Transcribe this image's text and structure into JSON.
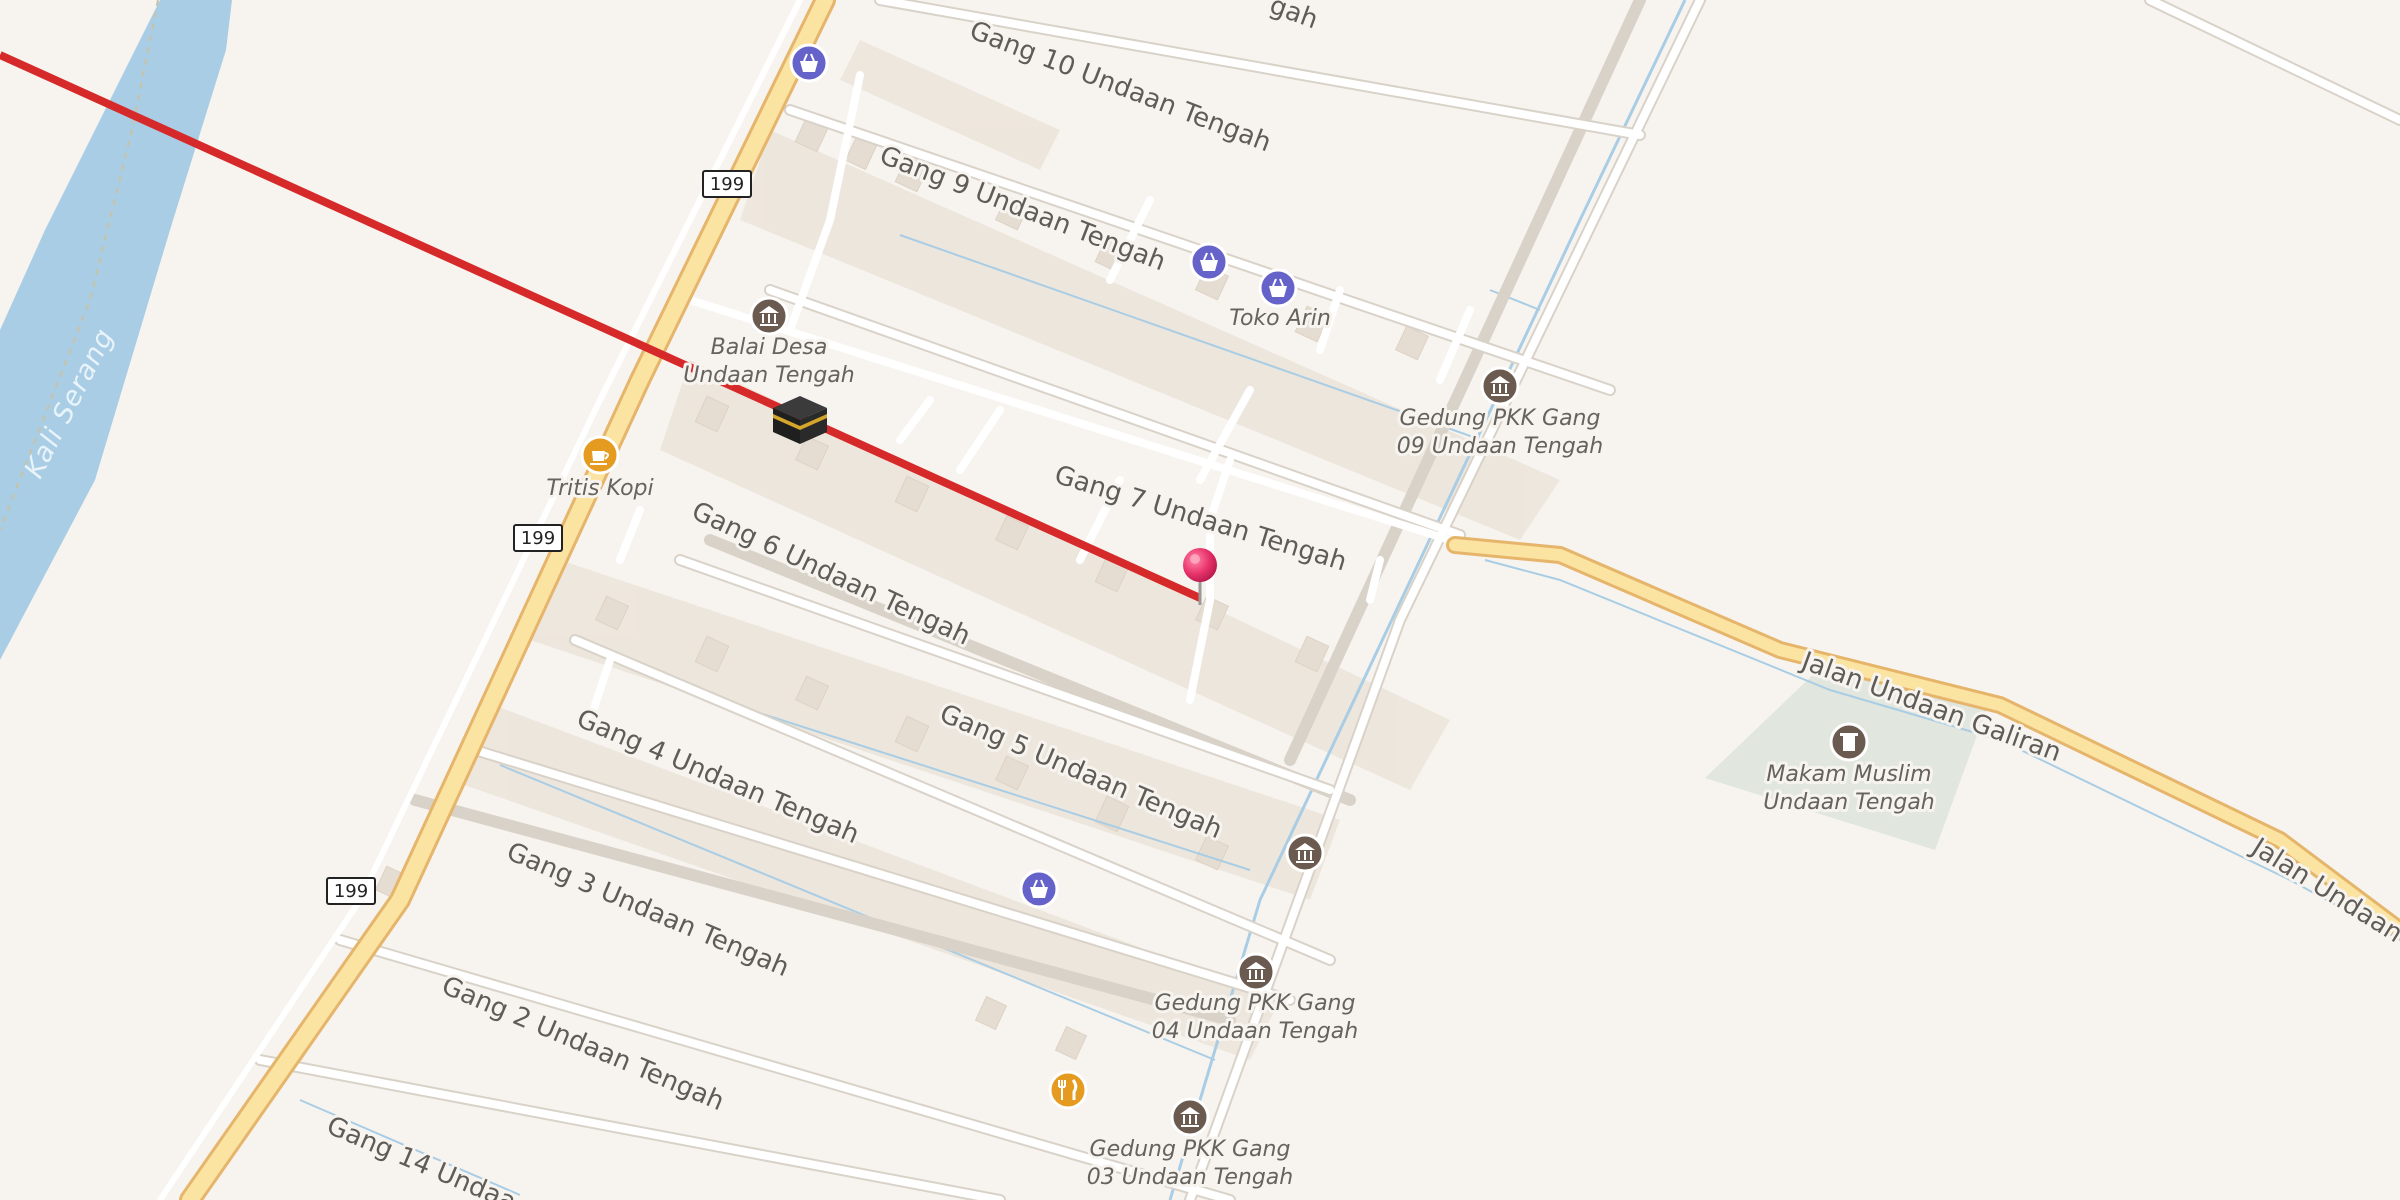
{
  "map": {
    "water": {
      "river_name": "Kali Serang"
    },
    "road_shields": [
      "199",
      "199",
      "199"
    ],
    "streets": {
      "gang10": "Gang 10 Undaan Tengah",
      "gang9": "Gang 9 Undaan Tengah",
      "gang7": "Gang 7 Undaan Tengah",
      "gang6": "Gang 6 Undaan Tengah",
      "gang5": "Gang 5 Undaan Tengah",
      "gang4": "Gang 4 Undaan Tengah",
      "gang3": "Gang 3 Undaan Tengah",
      "gang2": "Gang 2 Undaan Tengah",
      "gang14": "Gang 14 Undaa",
      "top_cut": "gah",
      "jalan1": "Jalan Undaan Galiran",
      "jalan2": "Jalan Undaan G"
    },
    "pois": {
      "toko_arin": "Toko Arin",
      "balai_desa_1": "Balai Desa",
      "balai_desa_2": "Undaan Tengah",
      "pkk09_1": "Gedung PKK Gang",
      "pkk09_2": "09 Undaan Tengah",
      "tritis": "Tritis Kopi",
      "makam_1": "Makam Muslim",
      "makam_2": "Undaan Tengah",
      "pkk04_1": "Gedung PKK Gang",
      "pkk04_2": "04 Undaan Tengah",
      "pkk03_1": "Gedung PKK Gang",
      "pkk03_2": "03 Undaan Tengah"
    },
    "icons": {
      "shop": "shopping-basket-icon",
      "townhall": "town-hall-icon",
      "cafe": "coffee-cup-icon",
      "restaurant": "fork-knife-icon",
      "cemetery": "grave-icon",
      "mosque": "kaaba-icon",
      "pin": "location-pin-icon"
    },
    "colors": {
      "background": "#f7f4f0",
      "river": "#a9cde4",
      "main_road": "#fbe3a1",
      "road_casing": "#e6b56c",
      "street": "#ffffff",
      "route_line": "#d62a2a",
      "shop_poi": "#6562c9",
      "civic_poi": "#6b5a50",
      "food_poi": "#e49b1f",
      "pin": "#e8336b"
    }
  }
}
